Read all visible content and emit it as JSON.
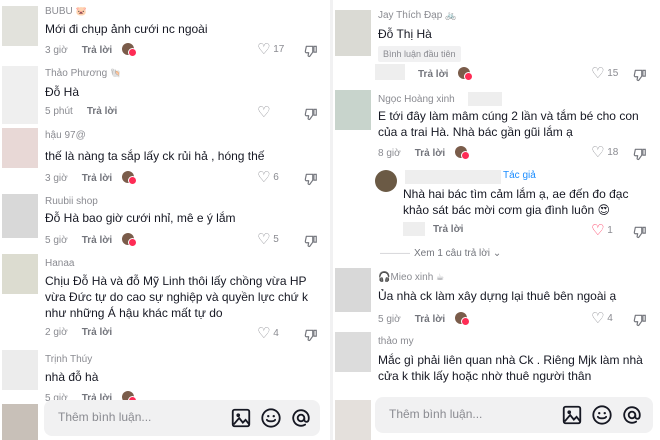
{
  "left": {
    "comments": [
      {
        "username": "BUBU",
        "emoji": "🐷",
        "text": "Mới đi chụp ảnh cưới nc ngoài",
        "time": "3 giờ",
        "reply": "Trả lời",
        "likes": "17"
      },
      {
        "username": "Thảo Phương",
        "emoji": "🐚",
        "text": "Đỗ Hà",
        "time": "5 phút",
        "reply": "Trả lời",
        "likes": ""
      },
      {
        "username": "hậu 97@",
        "emoji": "",
        "text": "thế là nàng ta sắp lấy ck rủi hả , hóng thế",
        "time": "3 giờ",
        "reply": "Trả lời",
        "likes": "6"
      },
      {
        "username": "Ruubii shop",
        "emoji": "",
        "text": "Đỗ Hà bao giờ cưới nhỉ, mê e ý lắm",
        "time": "5 giờ",
        "reply": "Trả lời",
        "likes": "5"
      },
      {
        "username": "Hanaa",
        "emoji": "",
        "text": "Chịu Đỗ Hà và đỗ Mỹ Linh thôi lấy chồng vừa HP vừa Đức tự do cao sự nghiệp và quyền lực chứ k như những Á hậu khác mất tự do",
        "time": "2 giờ",
        "reply": "Trả lời",
        "likes": "4"
      },
      {
        "username": "Trịnh Thúy",
        "emoji": "",
        "text": "nhà đỗ hà",
        "time": "5 giờ",
        "reply": "Trả lời",
        "likes": ""
      }
    ],
    "input_placeholder": "Thêm bình luận..."
  },
  "right": {
    "comments": [
      {
        "username": "Jay Thích Đạp",
        "emoji": "🚲",
        "text": "Đỗ Thị Hà",
        "badge": "Bình luận đầu tiên",
        "time": "",
        "reply": "Trả lời",
        "likes": "15"
      },
      {
        "username": "Ngọc Hoàng xinh",
        "emoji": "",
        "text": "E tới đây làm mâm cúng 2 lần và tắm bé cho con của a trai Hà. Nhà bác gần gũi lắm ạ",
        "time": "8 giờ",
        "reply": "Trả lời",
        "likes": "18"
      },
      {
        "username": "",
        "tag": "Tác giả",
        "emoji": "",
        "text": "Nhà hai bác tìm cảm lắm ạ, ae đến đo đạc khảo sát bác mời cơm gia đình luôn 😍",
        "time": "",
        "reply": "Trả lời",
        "likes": "1"
      },
      {
        "username": "Mieo xinh",
        "emoji": "☕",
        "text": "Ủa nhà ck làm xây dựng lại thuê bên ngoài ạ",
        "time": "5 giờ",
        "reply": "Trả lời",
        "likes": "4"
      },
      {
        "username": "thảo my",
        "emoji": "",
        "text": "Mắc gì phải liên quan nhà Ck . Riêng Mjk làm nhà cửa k thik lấy hoặc nhờ thuê người thân",
        "time": "",
        "reply": "",
        "likes": ""
      }
    ],
    "view_replies": "Xem 1 câu trả lời",
    "input_placeholder": "Thêm bình luận..."
  },
  "icons": [
    "heart-icon",
    "dislike-icon",
    "image-icon",
    "emoji-icon",
    "mention-icon",
    "chevron-down-icon"
  ],
  "colors": {
    "text": "#161823",
    "muted": "#8a8b91",
    "accent": "#fe2c55",
    "author": "#1a8cff",
    "input_bg": "#f1f1f2"
  }
}
